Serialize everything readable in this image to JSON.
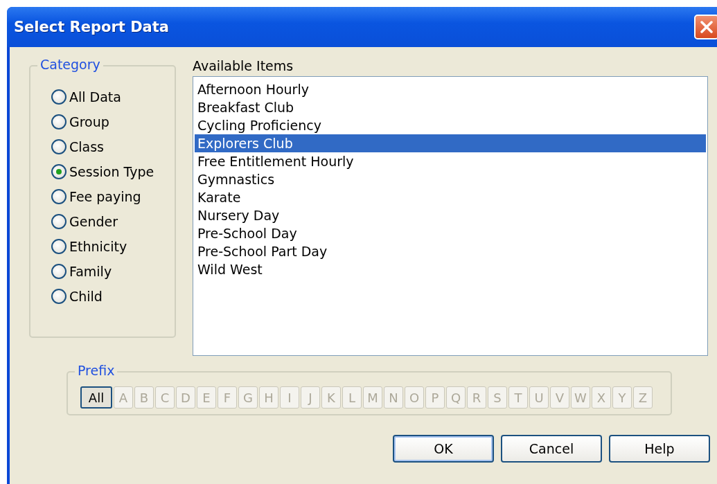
{
  "window": {
    "title": "Select Report Data"
  },
  "category": {
    "legend": "Category",
    "options": [
      {
        "label": "All Data",
        "selected": false
      },
      {
        "label": "Group",
        "selected": false
      },
      {
        "label": "Class",
        "selected": false
      },
      {
        "label": "Session Type",
        "selected": true
      },
      {
        "label": "Fee paying",
        "selected": false
      },
      {
        "label": "Gender",
        "selected": false
      },
      {
        "label": "Ethnicity",
        "selected": false
      },
      {
        "label": "Family",
        "selected": false
      },
      {
        "label": "Child",
        "selected": false
      }
    ]
  },
  "available_items": {
    "label": "Available Items",
    "items": [
      {
        "label": "Afternoon Hourly",
        "selected": false
      },
      {
        "label": "Breakfast Club",
        "selected": false
      },
      {
        "label": "Cycling Proficiency",
        "selected": false
      },
      {
        "label": "Explorers Club",
        "selected": true
      },
      {
        "label": "Free Entitlement Hourly",
        "selected": false
      },
      {
        "label": "Gymnastics",
        "selected": false
      },
      {
        "label": "Karate",
        "selected": false
      },
      {
        "label": "Nursery Day",
        "selected": false
      },
      {
        "label": "Pre-School Day",
        "selected": false
      },
      {
        "label": "Pre-School Part Day",
        "selected": false
      },
      {
        "label": "Wild West",
        "selected": false
      }
    ]
  },
  "prefix": {
    "legend": "Prefix",
    "buttons": [
      {
        "label": "All",
        "selected": true,
        "disabled": false
      },
      {
        "label": "A",
        "selected": false,
        "disabled": true
      },
      {
        "label": "B",
        "selected": false,
        "disabled": true
      },
      {
        "label": "C",
        "selected": false,
        "disabled": true
      },
      {
        "label": "D",
        "selected": false,
        "disabled": true
      },
      {
        "label": "E",
        "selected": false,
        "disabled": true
      },
      {
        "label": "F",
        "selected": false,
        "disabled": true
      },
      {
        "label": "G",
        "selected": false,
        "disabled": true
      },
      {
        "label": "H",
        "selected": false,
        "disabled": true
      },
      {
        "label": "I",
        "selected": false,
        "disabled": true
      },
      {
        "label": "J",
        "selected": false,
        "disabled": true
      },
      {
        "label": "K",
        "selected": false,
        "disabled": true
      },
      {
        "label": "L",
        "selected": false,
        "disabled": true
      },
      {
        "label": "M",
        "selected": false,
        "disabled": true
      },
      {
        "label": "N",
        "selected": false,
        "disabled": true
      },
      {
        "label": "O",
        "selected": false,
        "disabled": true
      },
      {
        "label": "P",
        "selected": false,
        "disabled": true
      },
      {
        "label": "Q",
        "selected": false,
        "disabled": true
      },
      {
        "label": "R",
        "selected": false,
        "disabled": true
      },
      {
        "label": "S",
        "selected": false,
        "disabled": true
      },
      {
        "label": "T",
        "selected": false,
        "disabled": true
      },
      {
        "label": "U",
        "selected": false,
        "disabled": true
      },
      {
        "label": "V",
        "selected": false,
        "disabled": true
      },
      {
        "label": "W",
        "selected": false,
        "disabled": true
      },
      {
        "label": "X",
        "selected": false,
        "disabled": true
      },
      {
        "label": "Y",
        "selected": false,
        "disabled": true
      },
      {
        "label": "Z",
        "selected": false,
        "disabled": true
      }
    ]
  },
  "buttons": [
    {
      "label": "OK",
      "default": true
    },
    {
      "label": "Cancel",
      "default": false
    },
    {
      "label": "Help",
      "default": false
    }
  ]
}
